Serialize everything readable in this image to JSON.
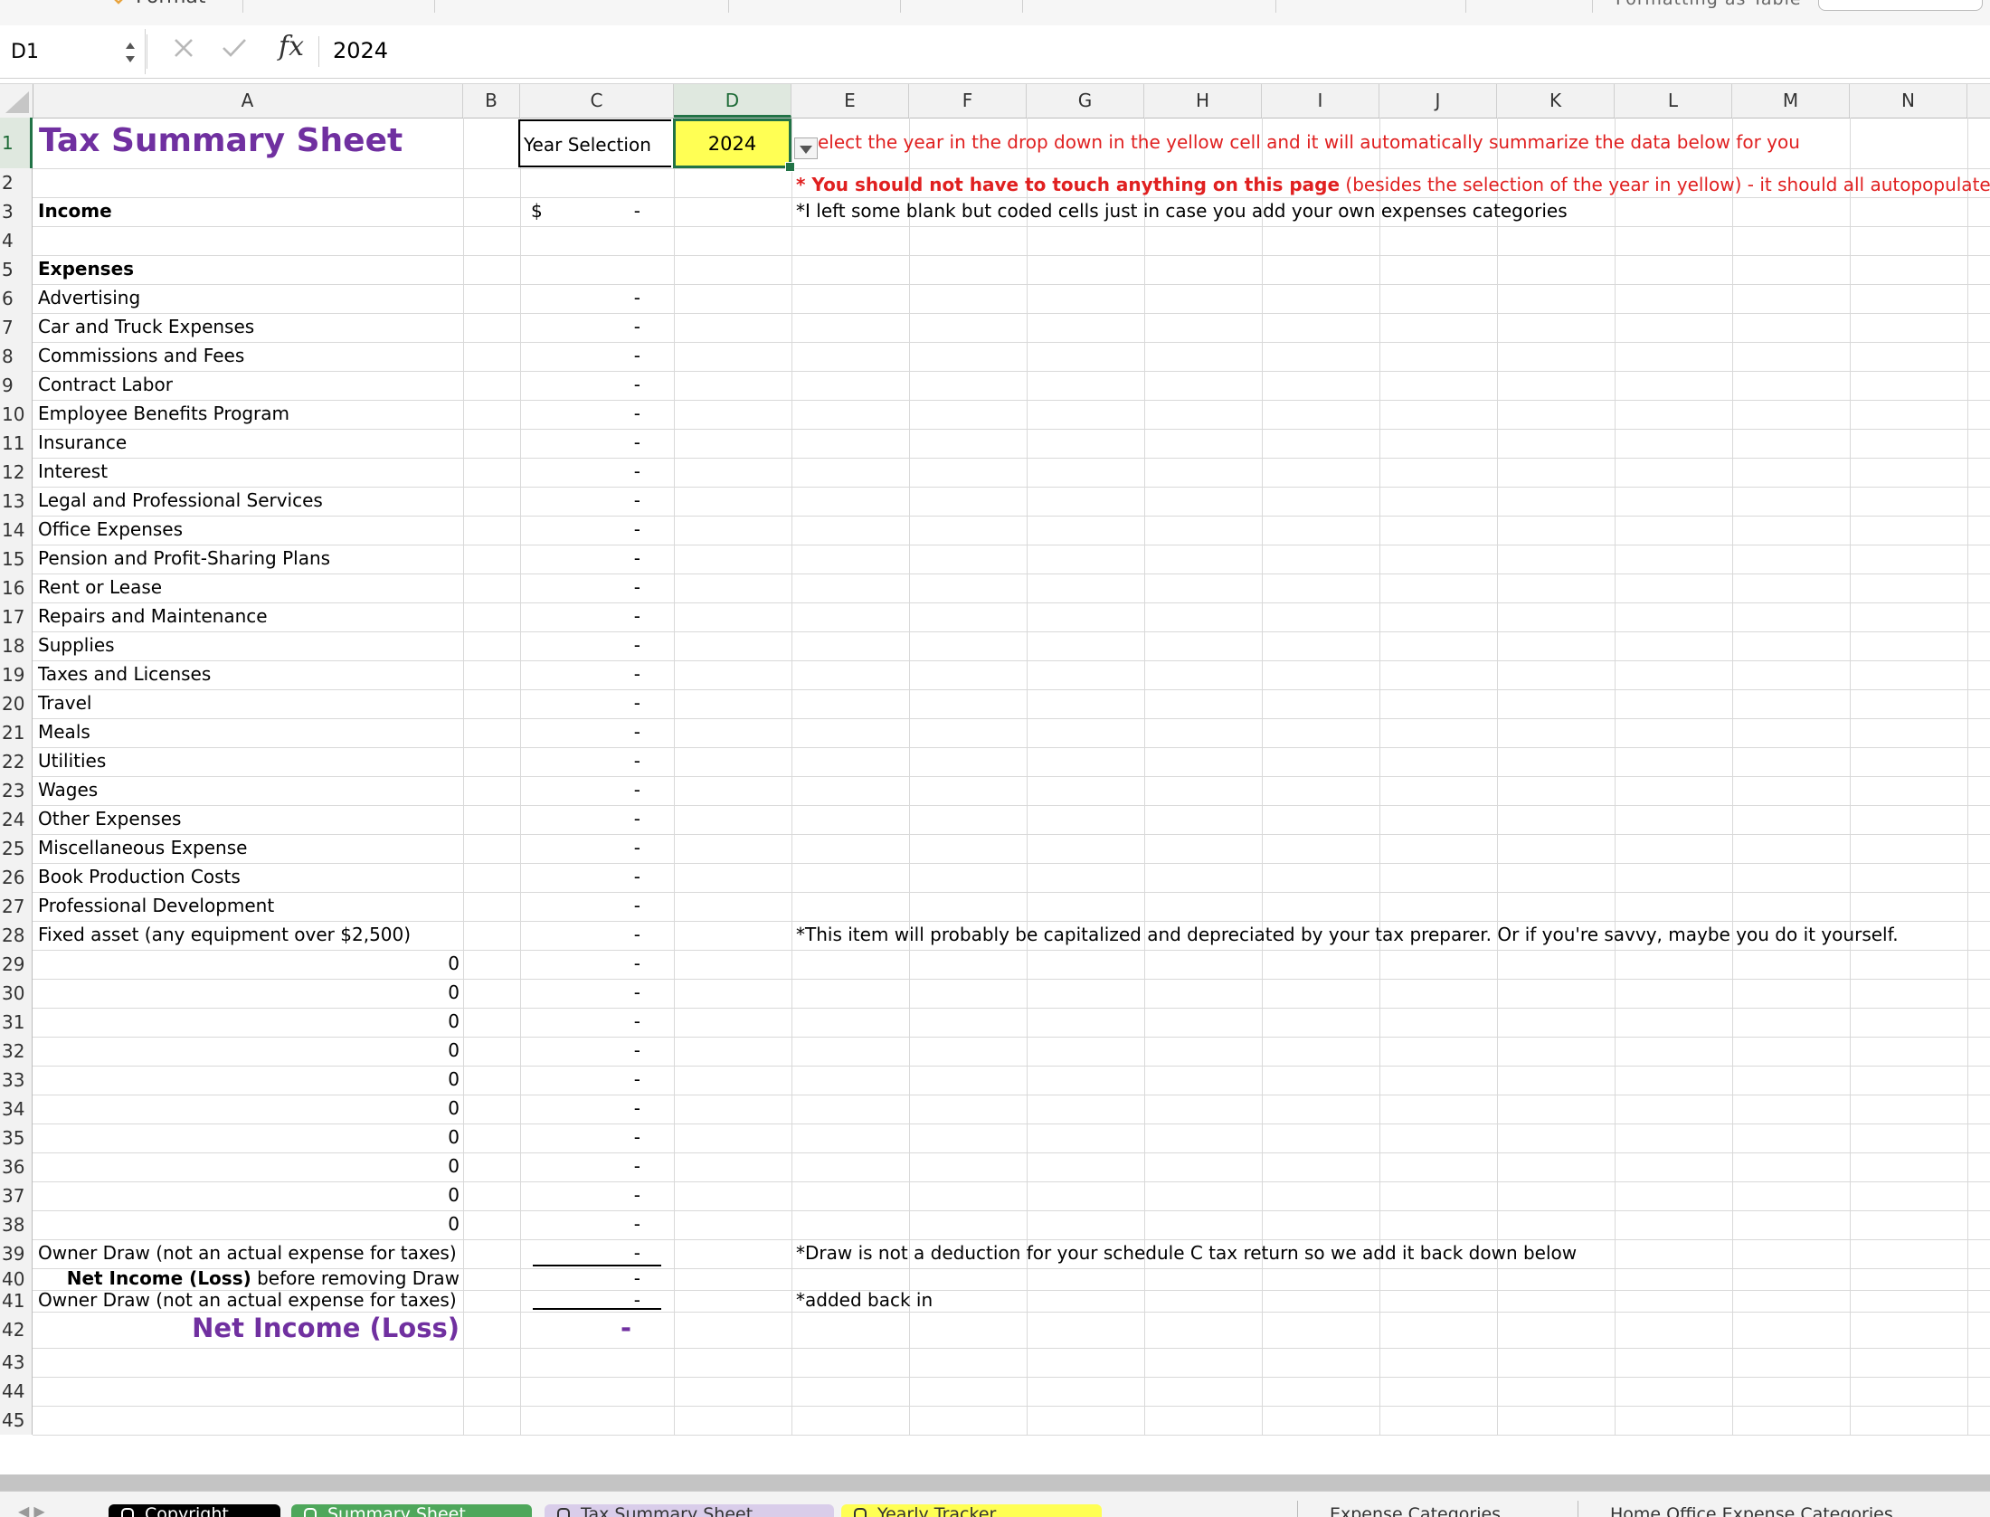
{
  "ribbon": {
    "format_label": "Format",
    "format_as_table_label": "Formatting   as Table"
  },
  "formula_bar": {
    "name_box": "D1",
    "fx_label": "fx",
    "value": "2024"
  },
  "columns": [
    "A",
    "B",
    "C",
    "D",
    "E",
    "F",
    "G",
    "H",
    "I",
    "J",
    "K",
    "L",
    "M",
    "N"
  ],
  "selected_column": "D",
  "rows": [
    "1",
    "2",
    "3",
    "4",
    "5",
    "6",
    "7",
    "8",
    "9",
    "10",
    "11",
    "12",
    "13",
    "14",
    "15",
    "16",
    "17",
    "18",
    "19",
    "20",
    "21",
    "22",
    "23",
    "24",
    "25",
    "26",
    "27",
    "28",
    "29",
    "30",
    "31",
    "32",
    "33",
    "34",
    "35",
    "36",
    "37",
    "38",
    "39",
    "40",
    "41",
    "42",
    "43",
    "44",
    "45"
  ],
  "sheet": {
    "title": "Tax Summary Sheet",
    "year_selection_label": "Year Selection",
    "year_value": "2024",
    "income_label": "Income",
    "income_currency": "$",
    "income_value": "-",
    "expenses_label": "Expenses",
    "expense_items": [
      {
        "label": "Advertising",
        "value": "-"
      },
      {
        "label": "Car and Truck Expenses",
        "value": "-"
      },
      {
        "label": "Commissions and Fees",
        "value": "-"
      },
      {
        "label": "Contract Labor",
        "value": "-"
      },
      {
        "label": "Employee Benefits Program",
        "value": "-"
      },
      {
        "label": "Insurance",
        "value": "-"
      },
      {
        "label": "Interest",
        "value": "-"
      },
      {
        "label": "Legal and Professional Services",
        "value": "-"
      },
      {
        "label": "Office Expenses",
        "value": "-"
      },
      {
        "label": "Pension and Profit-Sharing Plans",
        "value": "-"
      },
      {
        "label": "Rent or Lease",
        "value": "-"
      },
      {
        "label": "Repairs and Maintenance",
        "value": "-"
      },
      {
        "label": "Supplies",
        "value": "-"
      },
      {
        "label": "Taxes and Licenses",
        "value": "-"
      },
      {
        "label": "Travel",
        "value": "-"
      },
      {
        "label": "Meals",
        "value": "-"
      },
      {
        "label": "Utilities",
        "value": "-"
      },
      {
        "label": "Wages",
        "value": "-"
      },
      {
        "label": "Other Expenses",
        "value": "-"
      },
      {
        "label": "Miscellaneous Expense",
        "value": "-"
      },
      {
        "label": "Book Production Costs",
        "value": "-"
      },
      {
        "label": "Professional Development",
        "value": "-"
      },
      {
        "label": "Fixed asset (any equipment over $2,500)",
        "value": "-"
      }
    ],
    "blank_items": [
      {
        "label": "0",
        "value": "-"
      },
      {
        "label": "0",
        "value": "-"
      },
      {
        "label": "0",
        "value": "-"
      },
      {
        "label": "0",
        "value": "-"
      },
      {
        "label": "0",
        "value": "-"
      },
      {
        "label": "0",
        "value": "-"
      },
      {
        "label": "0",
        "value": "-"
      },
      {
        "label": "0",
        "value": "-"
      },
      {
        "label": "0",
        "value": "-"
      },
      {
        "label": "0",
        "value": "-"
      }
    ],
    "owner_draw_label": "Owner Draw (not an actual expense for taxes)",
    "owner_draw_value": "-",
    "net_before_bold": "Net Income (Loss)",
    "net_before_rest": " before removing Draw",
    "net_before_value": "-",
    "owner_draw_addback_label": "Owner Draw (not an actual expense for taxes)",
    "owner_draw_addback_value": "-",
    "net_income_label": "Net Income (Loss)",
    "net_income_value": "-"
  },
  "notes": {
    "row1": "elect the year in the drop down in the yellow cell and it will automatically summarize the data below for you",
    "row2_bold": "* You should not have to touch anything on this page",
    "row2_rest": " (besides the selection of the year in yellow) - it should all autopopulate for you",
    "row3": "*I left some blank but coded cells just in case you add your own expenses categories",
    "row28": "*This item will probably be capitalized and depreciated by your tax preparer. Or if you're savvy, maybe you do it yourself.",
    "row39": "*Draw is not a deduction for your schedule C tax return so we add it back down below",
    "row41": "*added back in"
  },
  "sheet_tabs": [
    {
      "label": "Copyright",
      "bg": "#000000",
      "fg": "#ffffff"
    },
    {
      "label": "Summary Sheet",
      "bg": "#4ea75b",
      "fg": "#ffffff"
    },
    {
      "label": "Tax Summary Sheet",
      "bg": "#d9cdea",
      "fg": "#333333"
    },
    {
      "label": "Yearly Tracker",
      "bg": "#ffff54",
      "fg": "#333333"
    },
    {
      "label": "Expense Categories",
      "bg": "",
      "fg": "#333333"
    },
    {
      "label": "Home Office Expense Categories",
      "bg": "",
      "fg": "#333333"
    }
  ],
  "colors": {
    "title_purple": "#7030a0",
    "note_red": "#e02020",
    "year_yellow": "#ffff54",
    "selection_green": "#217346"
  }
}
